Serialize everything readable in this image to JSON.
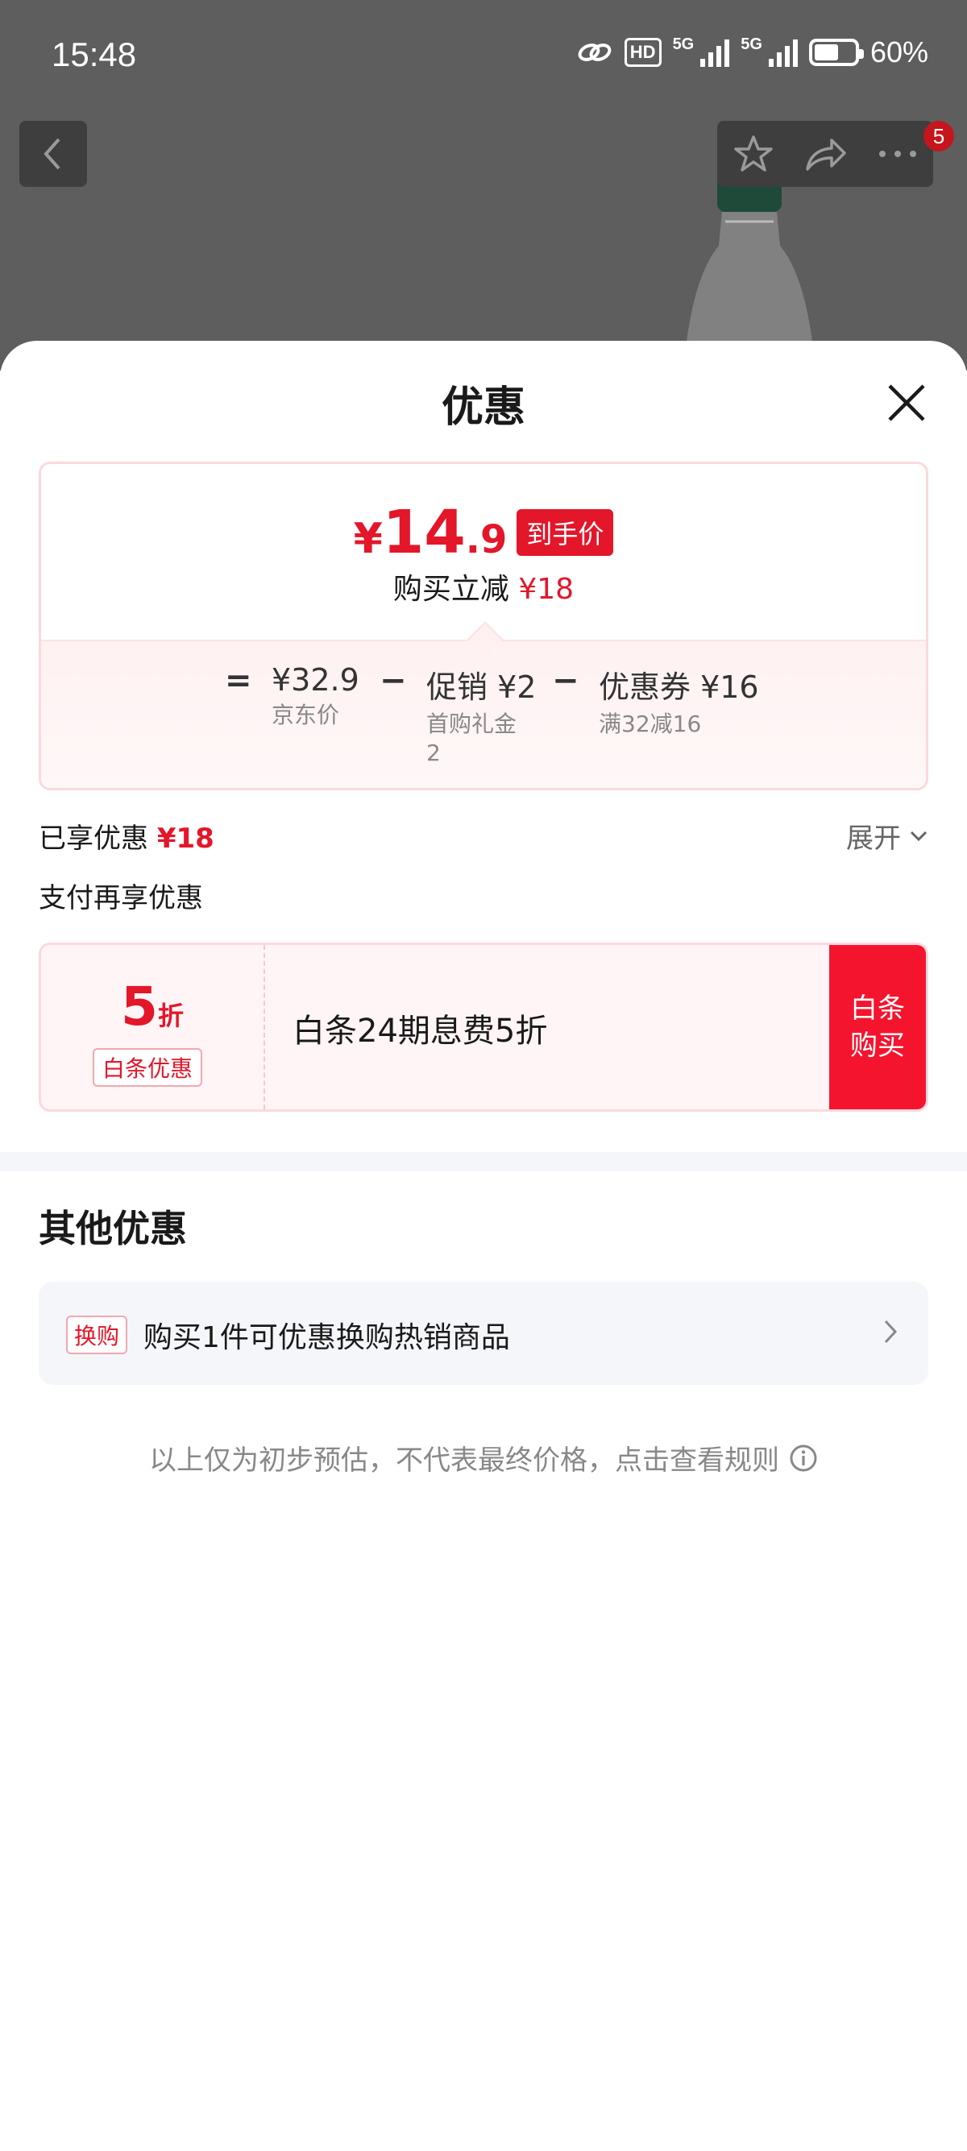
{
  "status_bar": {
    "time": "15:48",
    "network_hd": "HD",
    "network_5g_1": "5G",
    "network_5g_2": "5G",
    "battery": "60%",
    "battery_level": 0.6
  },
  "nav": {
    "badge_count": "5"
  },
  "sheet": {
    "title": "优惠",
    "final_price": {
      "yen": "¥",
      "integer": "14",
      "decimal": ".9",
      "tag": "到手价"
    },
    "reduce": {
      "label": "购买立减",
      "amount": "¥18"
    },
    "breakdown": {
      "equals": "=",
      "base_price": "¥32.9",
      "base_label": "京东价",
      "minus1": "−",
      "promo_title": "促销 ¥2",
      "promo_sub_line1": "首购礼金",
      "promo_sub_line2": "2",
      "minus2": "−",
      "coupon_title": "优惠券 ¥16",
      "coupon_sub": "满32减16"
    },
    "enjoyed": {
      "label": "已享优惠",
      "amount": "¥18",
      "expand": "展开"
    },
    "pay_more_label": "支付再享优惠",
    "baitiao": {
      "discount_number": "5",
      "discount_unit": "折",
      "tag": "白条优惠",
      "description": "白条24期息费5折",
      "button_line1": "白条",
      "button_line2": "购买"
    },
    "other": {
      "title": "其他优惠",
      "exchange_tag": "换购",
      "exchange_text": "购买1件可优惠换购热销商品"
    },
    "note": "以上仅为初步预估，不代表最终价格，点击查看规则"
  },
  "colors": {
    "accent_red": "#e4162a",
    "button_red": "#f5142d",
    "overlay": "#5e5e5e"
  }
}
